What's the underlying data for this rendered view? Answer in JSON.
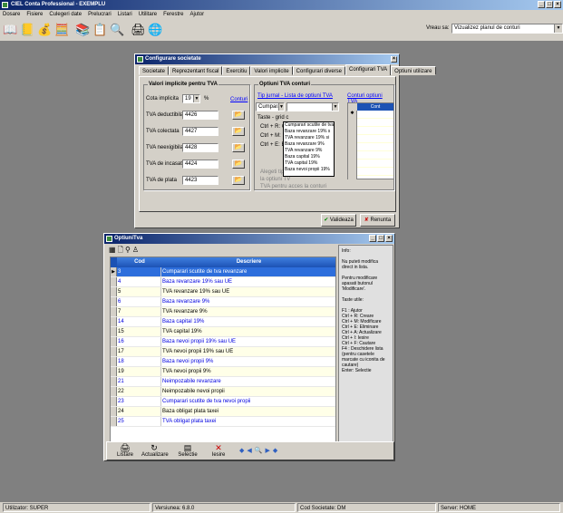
{
  "app": {
    "title": "CIEL Conta Professional - EXEMPLU"
  },
  "menu": [
    "Dosare",
    "Fisiere",
    "Culegeri date",
    "Prelucrari",
    "Listari",
    "Utilitare",
    "Ferestre",
    "Ajutor"
  ],
  "toolbar": {
    "icons": [
      "open-book",
      "ledger",
      "coins",
      "calculator",
      "books",
      "spreadsheet",
      "search",
      "printer",
      "globe"
    ],
    "want_label": "Vreau sa:",
    "want_value": "Vizualizez planul de conturi"
  },
  "config": {
    "title": "Configurare societate",
    "tabs": [
      "Societate",
      "Reprezentant fiscal",
      "Exercitiu",
      "Valori implicite",
      "Configurari diverse",
      "Configurari TVA",
      "Optiuni utilizare"
    ],
    "active_tab": "Configurari TVA",
    "left": {
      "title": "Valori implicite pentru TVA",
      "cota_label": "Cota implicita",
      "cota_value": "19",
      "pct": "%",
      "conturi": "Conturi",
      "rows": [
        {
          "label": "TVA deductibila",
          "value": "4426"
        },
        {
          "label": "TVA colectata",
          "value": "4427"
        },
        {
          "label": "TVA neexigibila",
          "value": "4428"
        },
        {
          "label": "TVA de incasat",
          "value": "4424"
        },
        {
          "label": "TVA de plata",
          "value": "4423"
        }
      ]
    },
    "right": {
      "title": "Optiuni TVA conturi",
      "tip_label": "Tip jurnal - Lista de optiuni TVA",
      "conturi_label": "Conturi optiuni TVA",
      "tip_value": "Cumparari",
      "col_cont": "Cont",
      "taste": "Taste - grid c",
      "k1": "Ctrl + R: Cre",
      "k2": "Ctrl + M: Mo",
      "k3": "Ctrl + E: Eli",
      "hint1": "Alegeti tipul",
      "hint2": "la optiuni TV",
      "hint3": "TVA pentru acces la conturi"
    },
    "dropdown": [
      "Cumparari scutite de tva",
      "Baza revanzare 19% s",
      "TVA revanzare 19% si",
      "Baza revanzare 9%",
      "TVA revanzare 9%",
      "Baza capital 19%",
      "TVA capital 19%",
      "Baza nevoi propii 19%"
    ],
    "ok": "Valideaza",
    "cancel": "Renunta"
  },
  "otva": {
    "title": "OptiuniTva",
    "col_cod": "Cod",
    "col_desc": "Descriere",
    "rows": [
      {
        "cod": "3",
        "desc": "Cumparari scutite de tva revanzare",
        "style": "sel"
      },
      {
        "cod": "4",
        "desc": "Baza revanzare 19% sau UE",
        "style": "b"
      },
      {
        "cod": "5",
        "desc": "TVA revanzare 19% sau UE",
        "style": "n"
      },
      {
        "cod": "6",
        "desc": "Baza revanzare 9%",
        "style": "b"
      },
      {
        "cod": "7",
        "desc": "TVA revanzare 9%",
        "style": "n"
      },
      {
        "cod": "14",
        "desc": "Baza capital 19%",
        "style": "b"
      },
      {
        "cod": "15",
        "desc": "TVA capital 19%",
        "style": "n"
      },
      {
        "cod": "16",
        "desc": "Baza nevoi propii 19% sau UE",
        "style": "b"
      },
      {
        "cod": "17",
        "desc": "TVA nevoi propii 19% sau UE",
        "style": "n"
      },
      {
        "cod": "18",
        "desc": "Baza nevoi propii 9%",
        "style": "b"
      },
      {
        "cod": "19",
        "desc": "TVA nevoi propii 9%",
        "style": "n"
      },
      {
        "cod": "21",
        "desc": "Neimpozabile revanzare",
        "style": "b"
      },
      {
        "cod": "22",
        "desc": "Neimpozabile nevoi propii",
        "style": "n"
      },
      {
        "cod": "23",
        "desc": "Cumparari scutite de tva nevoi propii",
        "style": "b"
      },
      {
        "cod": "24",
        "desc": "Baza obligat plata taxei",
        "style": "n"
      },
      {
        "cod": "25",
        "desc": "TVA obligat plata taxei",
        "style": "b"
      }
    ],
    "info": "Info:\n\nNu puteti modifica direct in lista.\n\nPentru modificare apasati butonul 'Modificare'.\n\nTaste utile:\n\nF1 : Ajutor\nCtrl + R: Creare\nCtrl + M: Modificare\nCtrl + E: Eliminare\nCtrl + A: Actualizare\nCtrl + I: Iesire\nCtrl + F: Cautare\nF4 : Deschidere lista (pentru casetele marcate cu iconita de cautare)\nEnter: Selectie",
    "buttons": [
      "Listare",
      "Actualizare",
      "Selectie",
      "Iesire"
    ]
  },
  "status": {
    "user": "Utilizator: SUPER",
    "version": "Versiunea: 6.8.0",
    "company": "Cod Societate: DM",
    "server": "Server: HOME"
  }
}
